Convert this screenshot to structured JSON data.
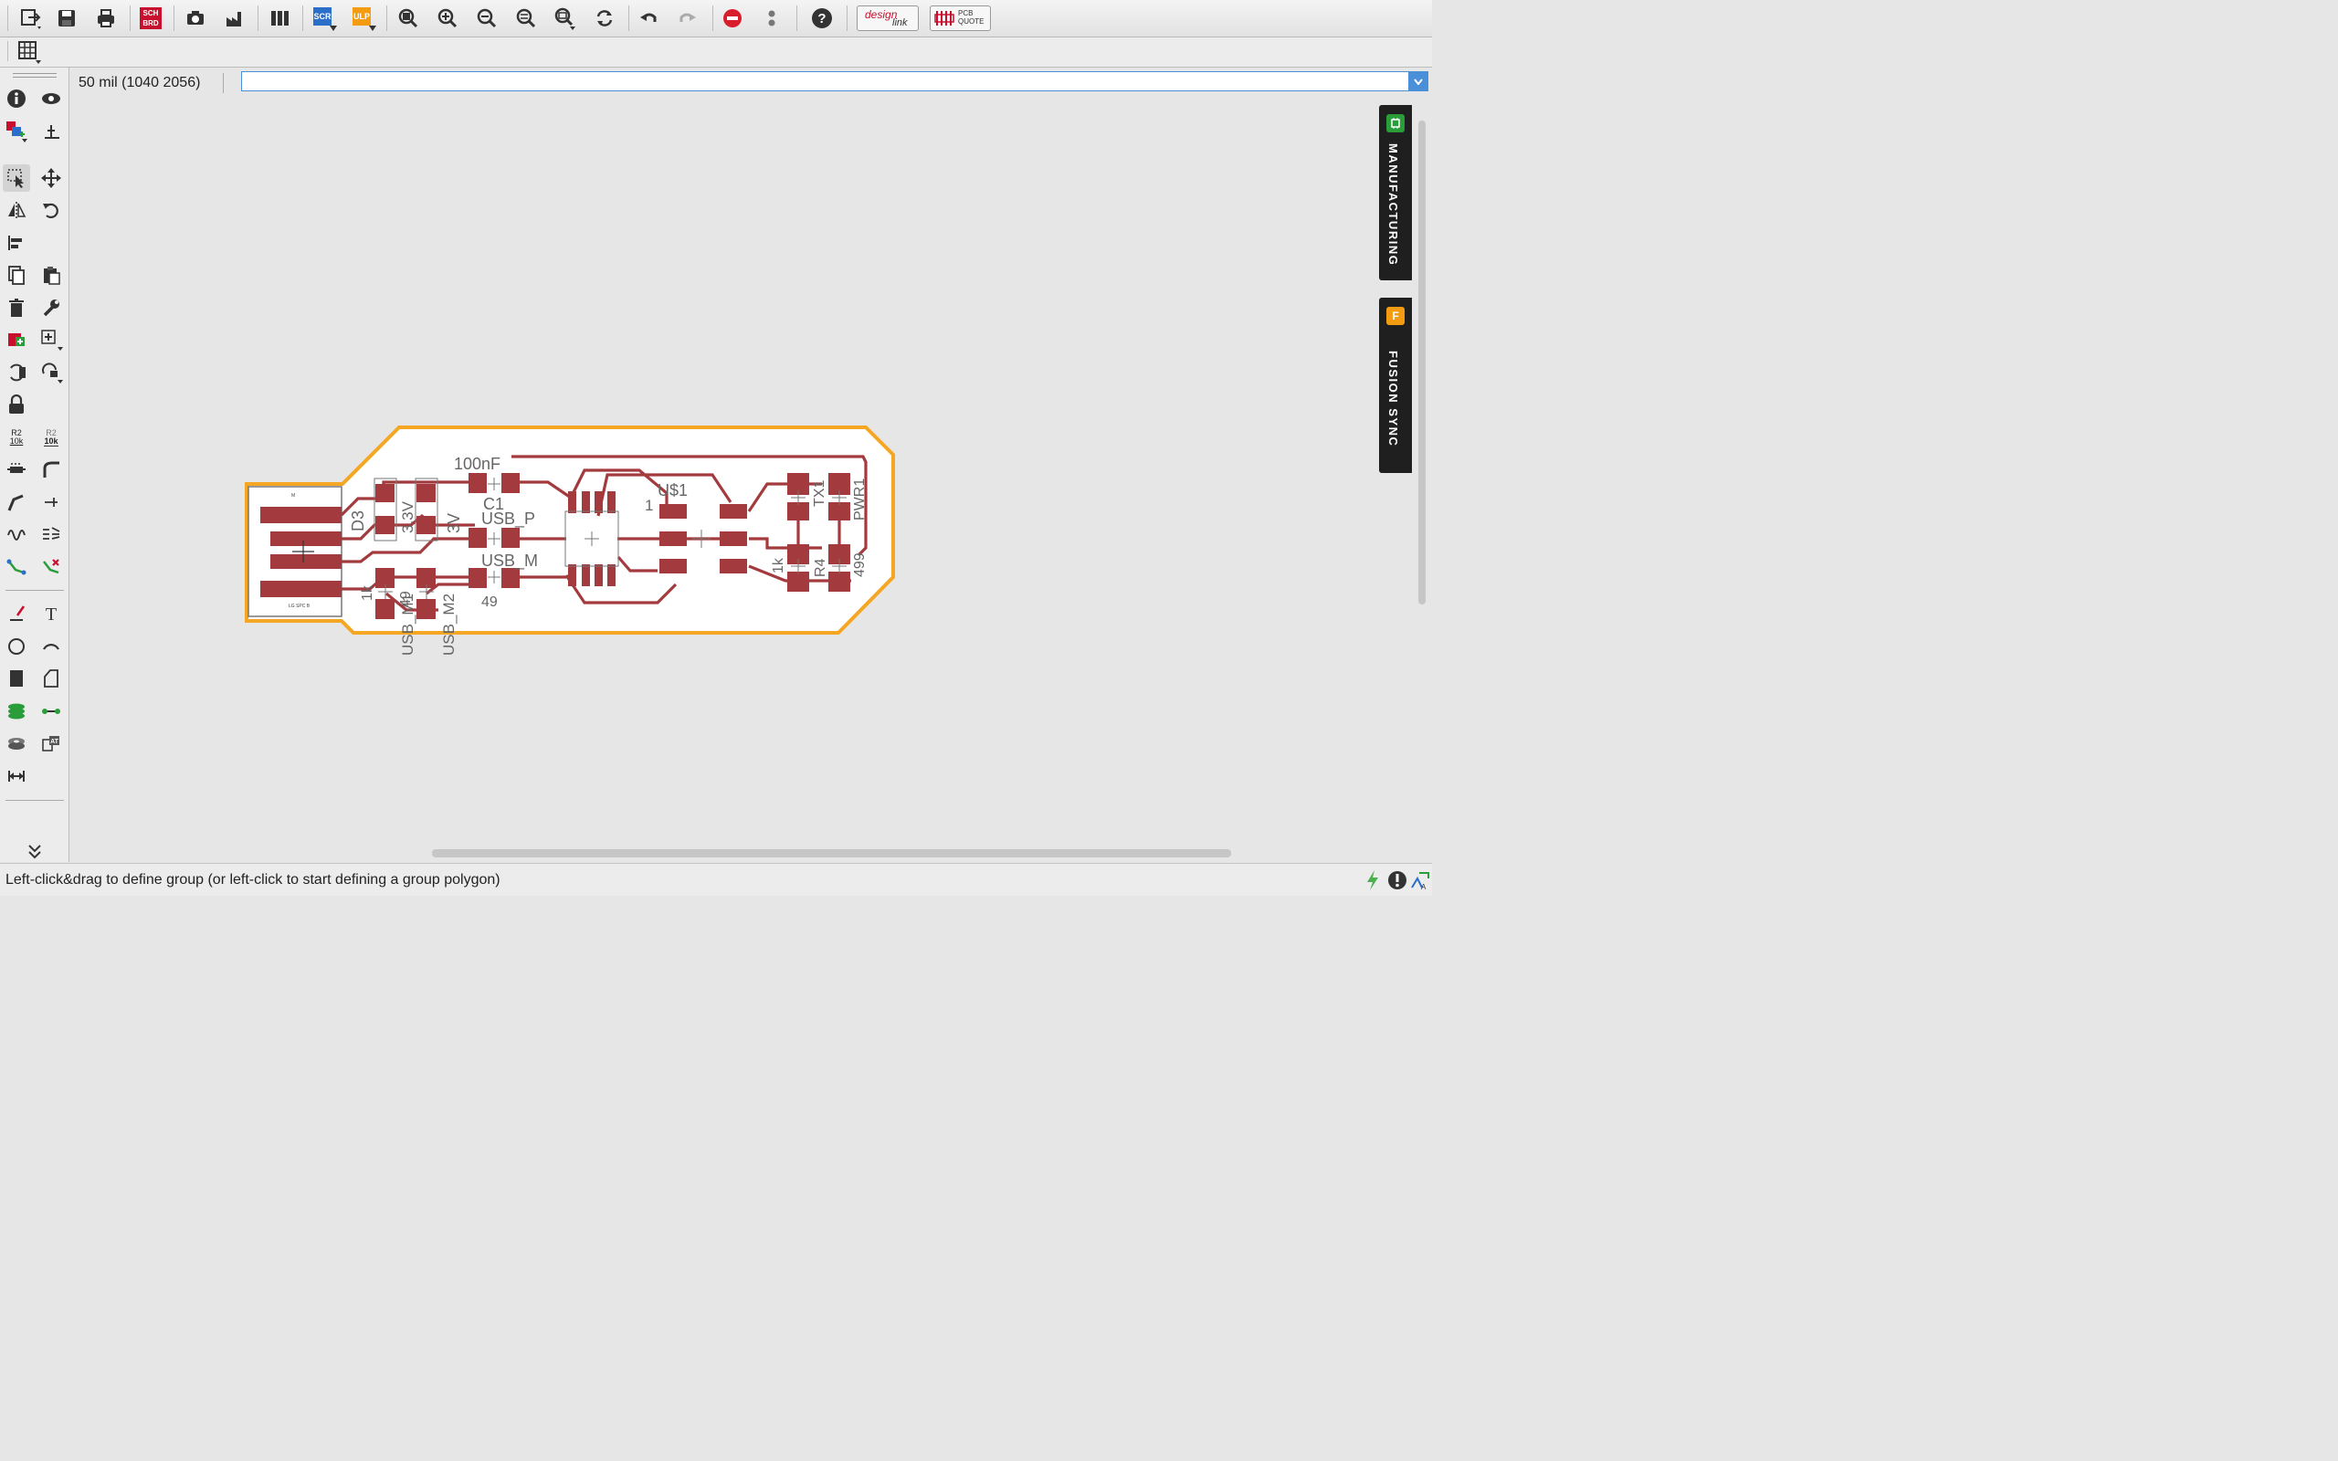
{
  "toolbar": {
    "items": [
      "open-icon",
      "save-icon",
      "print-icon",
      "sch-brd-switch",
      "cam-icon",
      "manufacture-icon",
      "library-icon",
      "script-button",
      "ulp-button",
      "zoom-fit-icon",
      "zoom-in-icon",
      "zoom-out-icon",
      "zoom-select-icon",
      "zoom-area-icon",
      "redraw-icon",
      "undo-icon",
      "redo-icon",
      "stop-icon",
      "pause-icon",
      "help-icon"
    ],
    "sch_label_top": "SCH",
    "sch_label_bottom": "BRD",
    "scr_label": "SCR",
    "ulp_label": "ULP",
    "designlink_label_1": "design",
    "designlink_label_2": "link",
    "pcbquote_label_1": "PCB",
    "pcbquote_label_2": "QUOTE"
  },
  "command": {
    "coordinates": "50 mil (1040 2056)",
    "input_value": "",
    "input_placeholder": ""
  },
  "side_panels": {
    "manufacturing": "MANUFACTURING",
    "fusion_sync": "FUSION SYNC"
  },
  "left_tools": {
    "r2_label": "R2",
    "val_10k": "10k"
  },
  "pcb": {
    "labels": {
      "c_value": "100nF",
      "c_name": "C1",
      "usb_p": "USB_P",
      "usb_m": "USB_M",
      "d3": "D3",
      "v33": "3.3V",
      "v3": "3V",
      "u1": "U$1",
      "pin1": "1",
      "r49_a": "49",
      "r49_b": "49",
      "usb_m1": "USB_M1",
      "usb_m2": "USB_M2",
      "r1k": "1k",
      "r1k_2": "1k",
      "tx1": "TX1",
      "pwr1": "PWR1",
      "r4": "R4",
      "r499": "499",
      "conn_top": "M",
      "conn_bottom": "LG SPC B"
    }
  },
  "status": {
    "message": "Left-click&drag to define group (or left-click to start defining a group polygon)"
  },
  "colors": {
    "board_outline": "#f5a623",
    "copper": "#a33a3e",
    "board_fill": "#ffffff",
    "accent_blue": "#4a90d9"
  }
}
